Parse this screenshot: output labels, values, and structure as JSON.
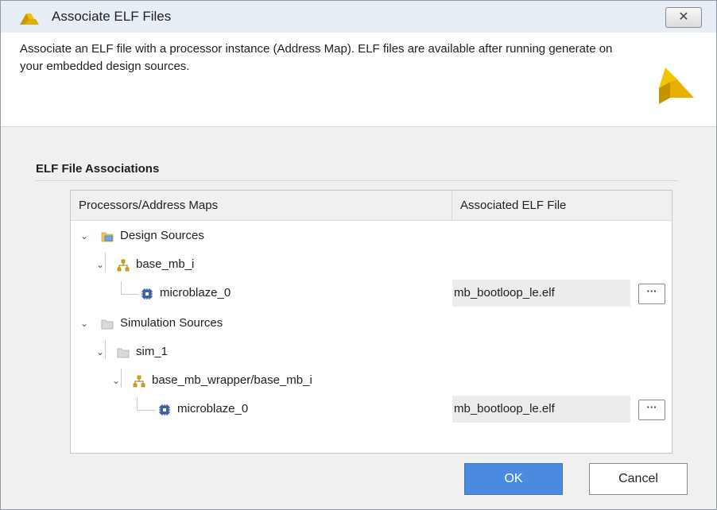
{
  "window": {
    "title": "Associate ELF Files",
    "close_label": "✕"
  },
  "header": {
    "description": "Associate an ELF file with a processor instance (Address Map). ELF files are available after running generate on your embedded design sources."
  },
  "section": {
    "title": "ELF File Associations"
  },
  "table": {
    "columns": [
      "Processors/Address Maps",
      "Associated ELF File"
    ],
    "rows": [
      {
        "label": "Design Sources",
        "icon": "design-sources-folder-icon",
        "elf": ""
      },
      {
        "label": "base_mb_i",
        "icon": "block-design-icon",
        "elf": ""
      },
      {
        "label": "microblaze_0",
        "icon": "processor-chip-icon",
        "elf": "mb_bootloop_le.elf",
        "browse": "···"
      },
      {
        "label": "Simulation Sources",
        "icon": "folder-icon",
        "elf": ""
      },
      {
        "label": "sim_1",
        "icon": "folder-icon",
        "elf": ""
      },
      {
        "label": "base_mb_wrapper/base_mb_i",
        "icon": "block-design-icon",
        "elf": ""
      },
      {
        "label": "microblaze_0",
        "icon": "processor-chip-icon",
        "elf": "mb_bootloop_le.elf",
        "browse": "···"
      }
    ]
  },
  "buttons": {
    "ok": "OK",
    "cancel": "Cancel"
  },
  "colors": {
    "accent": "#4a8bdf",
    "logo": "#d9a400"
  }
}
